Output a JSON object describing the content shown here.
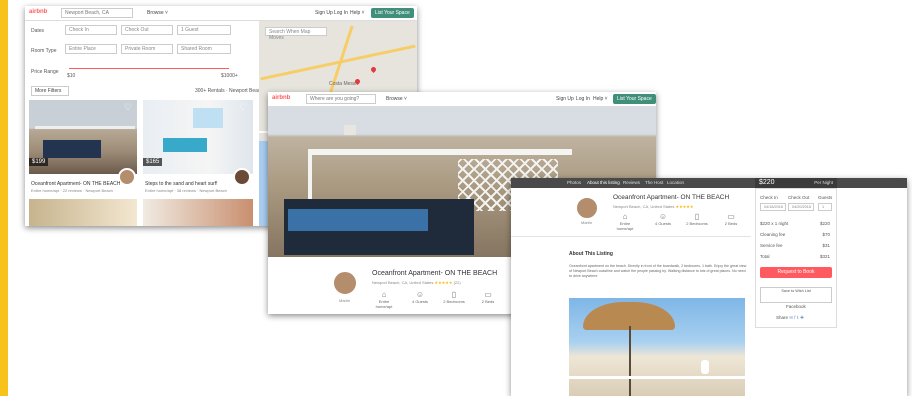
{
  "search_page": {
    "logo": "airbnb",
    "location": "Newport Beach, CA",
    "browse": "Browse ˅",
    "nav": [
      "Sign Up",
      "Log In",
      "Help ˅"
    ],
    "list_space": "List Your Space",
    "dates_label": "Dates",
    "check_in": "Check In",
    "check_out": "Check Out",
    "guests": "1 Guest",
    "room_type_label": "Room Type",
    "room_types": [
      "Entire Place",
      "Private Room",
      "Shared Room"
    ],
    "price_range_label": "Price Range",
    "price_min": "$10",
    "price_max": "$1000+",
    "more_filters": "More Filters",
    "results_text": "300+ Rentals · Newport Beach",
    "map_search_toggle": "Search When Map Moves",
    "map_city": "Costa Mesa",
    "listings": [
      {
        "price": "$199",
        "title": "Oceanfront Apartment- ON THE BEACH",
        "sub": "Entire home/apt · 22 reviews · Newport Beach"
      },
      {
        "price": "$165",
        "title": "Steps to the sand and heart surf!",
        "sub": "Entire home/apt · 38 reviews · Newport Beach"
      }
    ]
  },
  "listing_page": {
    "logo": "airbnb",
    "search_placeholder": "Where are you going?",
    "browse": "Browse ˅",
    "nav": [
      "Sign Up",
      "Log In",
      "Help ˅"
    ],
    "list_space": "List Your Space",
    "title": "Oceanfront Apartment- ON THE BEACH",
    "location": "Newport Beach, CA, United States",
    "stars": "★★★★★",
    "reviews": "(22)",
    "host_label": "Martin",
    "amenities": [
      "Entire home/apt",
      "4 Guests",
      "2 Bedrooms",
      "2 Beds"
    ]
  },
  "detail_page": {
    "nav_tabs": [
      "Photos",
      "About this listing",
      "Reviews",
      "The Host",
      "Location"
    ],
    "price": "$220",
    "per_night": "Per Night",
    "title": "Oceanfront Apartment- ON THE BEACH",
    "location": "Newport Beach, CA, United States",
    "stars": "★★★★★",
    "host_label": "Martin",
    "amenities": [
      "Entire home/apt",
      "4 Guests",
      "2 Bedrooms",
      "2 Beds"
    ],
    "about_heading": "About This Listing",
    "about_text": "Oceanfront apartment on the beach. Directly in front of the boardwalk, 2 bedrooms, 1 bath. Enjoy the great view of Newport Beach coastline and watch the people passing by. Walking distance to lots of great places. No need to drive anywhere.",
    "booking": {
      "check_in_label": "Check In",
      "check_out_label": "Check Out",
      "guests_label": "Guests",
      "check_in": "04/18/2016",
      "check_out": "04/20/2016",
      "guests": "1",
      "rows": [
        {
          "label": "$220 x 1 night",
          "value": "$220"
        },
        {
          "label": "Cleaning fee",
          "value": "$70"
        },
        {
          "label": "Service fee",
          "value": "$31"
        },
        {
          "label": "Total",
          "value": "$321"
        }
      ],
      "request_button": "Request to Book",
      "save_button": "Save to Wish List",
      "facebook_label": "Facebook",
      "share_label": "Share"
    }
  }
}
